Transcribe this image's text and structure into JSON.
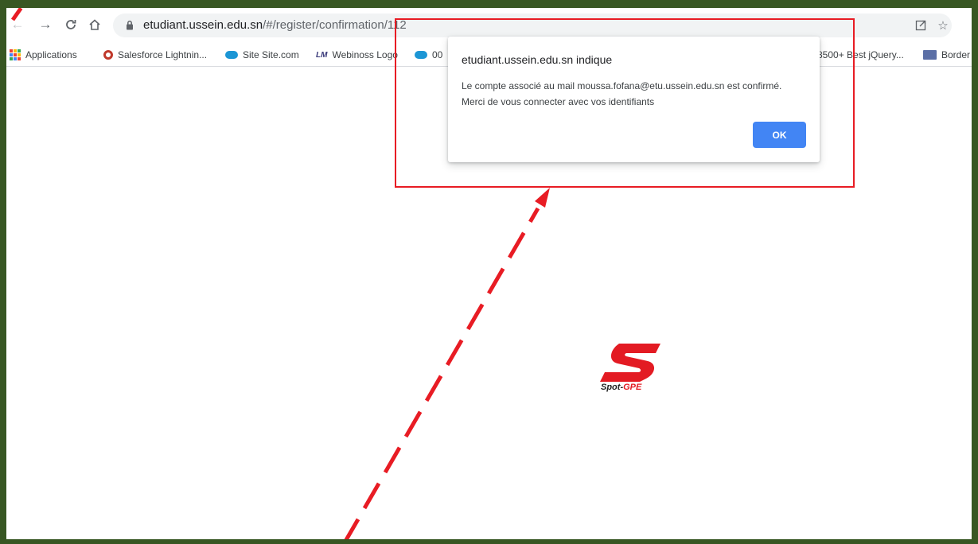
{
  "browser": {
    "url_host": "etudiant.ussein.edu.sn",
    "url_path": "/#/register/confirmation/112",
    "nav_icons": [
      "back-icon",
      "forward-icon",
      "reload-icon",
      "home-icon",
      "lock-icon",
      "open-in-new-icon",
      "star-icon"
    ]
  },
  "bookmarks": {
    "items": [
      {
        "label": "Applications",
        "icon": "apps-grid-icon"
      },
      {
        "label": "Salesforce Lightnin...",
        "icon": "salesforce-icon"
      },
      {
        "label": "Site Site.com",
        "icon": "cloud-icon"
      },
      {
        "label": "Webinoss Logo",
        "icon": "lm-icon"
      },
      {
        "label": "00",
        "icon": "cloud-icon"
      },
      {
        "label": "8500+ Best jQuery...",
        "icon": ""
      },
      {
        "label": "Border",
        "icon": "folder-icon"
      }
    ]
  },
  "dialog": {
    "title": "etudiant.ussein.edu.sn indique",
    "message": "Le compte associé au mail moussa.fofana@etu.ussein.edu.sn est confirmé. Merci de vous connecter avec vos identifiants",
    "ok_label": "OK"
  },
  "logo": {
    "text_dark": "Spot-",
    "text_red": "GPE"
  },
  "colors": {
    "frame": "#385723",
    "annotation_red": "#e81c24",
    "ok_button": "#4285f4",
    "logo_red": "#e31b23"
  }
}
